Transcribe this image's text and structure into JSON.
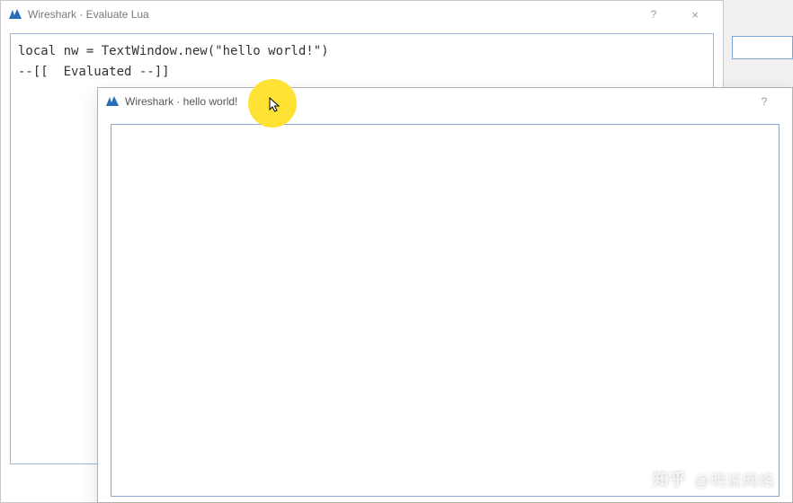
{
  "back_window": {
    "title": "Wireshark · Evaluate Lua",
    "help_label": "?",
    "close_label": "×",
    "code_line1": "local nw = TextWindow.new(\"hello world!\")",
    "code_line2": "",
    "code_line3": "--[[  Evaluated --]]"
  },
  "front_window": {
    "title": "Wireshark · hello world!",
    "help_label": "?"
  },
  "watermark": {
    "logo": "知乎",
    "text": "@明说网络"
  }
}
